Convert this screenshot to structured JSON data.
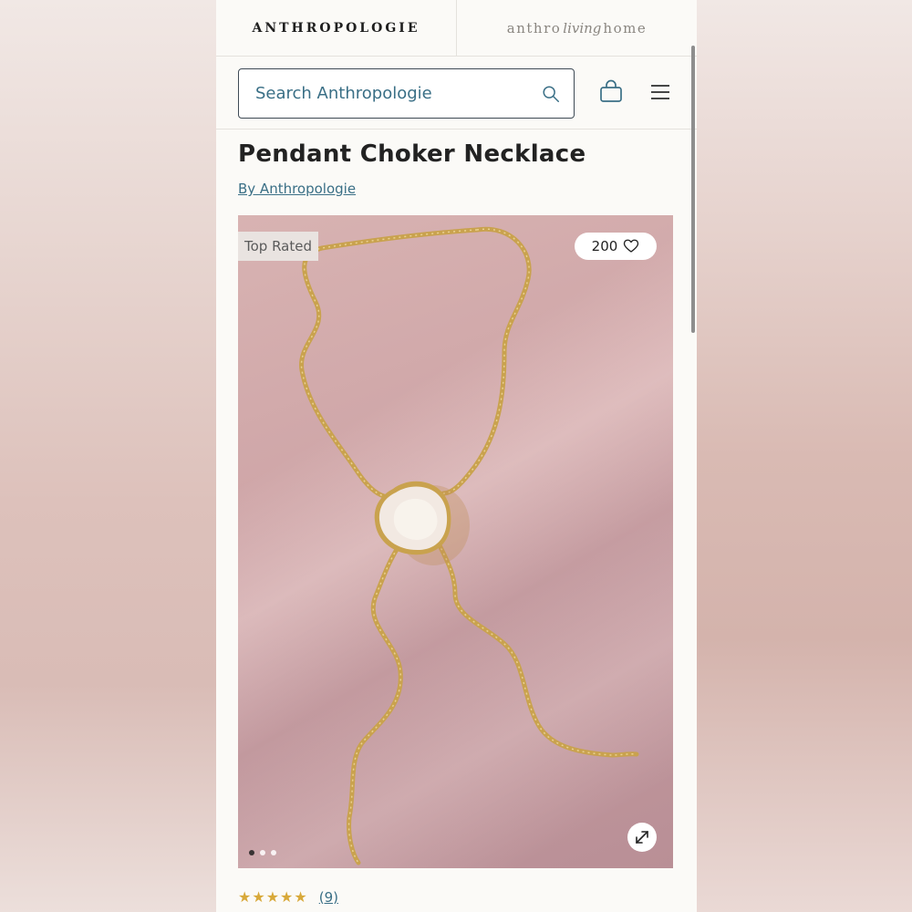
{
  "header": {
    "brand_primary": "ANTHROPOLOGIE",
    "brand_secondary_left": "anthro",
    "brand_secondary_script": "living",
    "brand_secondary_right": "home"
  },
  "search": {
    "placeholder": "Search Anthropologie",
    "value": ""
  },
  "icons": {
    "search": "search-icon",
    "bag": "shopping-bag-icon",
    "menu": "hamburger-menu-icon",
    "heart": "heart-icon",
    "expand": "expand-icon"
  },
  "product": {
    "title": "Pendant Choker Necklace",
    "byline": "By Anthropologie",
    "badge": "Top Rated",
    "likes": "200",
    "image_count": 3,
    "active_image_index": 0,
    "rating_stars": "★★★★★",
    "rating_value": 4.5,
    "review_count": "(9)"
  },
  "colors": {
    "accent": "#3a6f86",
    "star": "#d8a93a",
    "background": "#fbfaf7"
  }
}
